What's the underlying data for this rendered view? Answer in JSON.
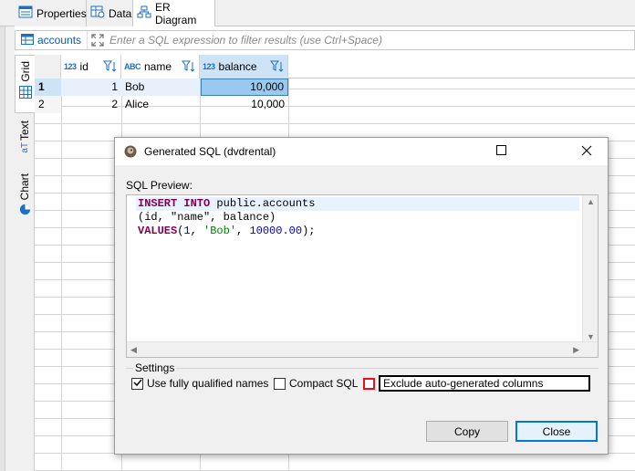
{
  "tabs": [
    {
      "label": "Properties",
      "icon": "properties-icon"
    },
    {
      "label": "Data",
      "icon": "data-icon"
    },
    {
      "label": "ER Diagram",
      "icon": "er-diagram-icon"
    }
  ],
  "side_tabs": [
    {
      "label": "Grid",
      "icon": "grid-icon"
    },
    {
      "label": "Text",
      "icon": "text-icon"
    },
    {
      "label": "Chart",
      "icon": "chart-icon"
    }
  ],
  "filter": {
    "table": "accounts",
    "placeholder": "Enter a SQL expression to filter results (use Ctrl+Space)"
  },
  "grid": {
    "columns": [
      {
        "type": "123",
        "name": "id"
      },
      {
        "type": "ABC",
        "name": "name"
      },
      {
        "type": "123",
        "name": "balance"
      }
    ],
    "rows": [
      {
        "num": "1",
        "id": "1",
        "name": "Bob",
        "balance": "10,000"
      },
      {
        "num": "2",
        "id": "2",
        "name": "Alice",
        "balance": "10,000"
      }
    ]
  },
  "dialog": {
    "title": "Generated SQL (dvdrental)",
    "preview_label": "SQL Preview:",
    "sql": {
      "line1_kw": "INSERT INTO",
      "line1_rest": " public.accounts",
      "line2": "(id, \"name\", balance)",
      "line3_kw": "VALUES",
      "line3_open": "(",
      "line3_n1": "1",
      "line3_sep1": ", ",
      "line3_s": "'Bob'",
      "line3_sep2": ", ",
      "line3_n2": "10000.00",
      "line3_close": ");"
    },
    "settings_label": "Settings",
    "options": [
      {
        "label": "Use fully qualified names",
        "checked": true
      },
      {
        "label": "Compact SQL",
        "checked": false
      },
      {
        "label": "Exclude auto-generated columns",
        "checked": false
      }
    ],
    "copy_label": "Copy",
    "close_label": "Close"
  },
  "colors": {
    "accent": "#0078d7",
    "keyword": "#7f0055",
    "string": "#008000",
    "number": "#0000c0",
    "selection": "#99c9ef"
  }
}
